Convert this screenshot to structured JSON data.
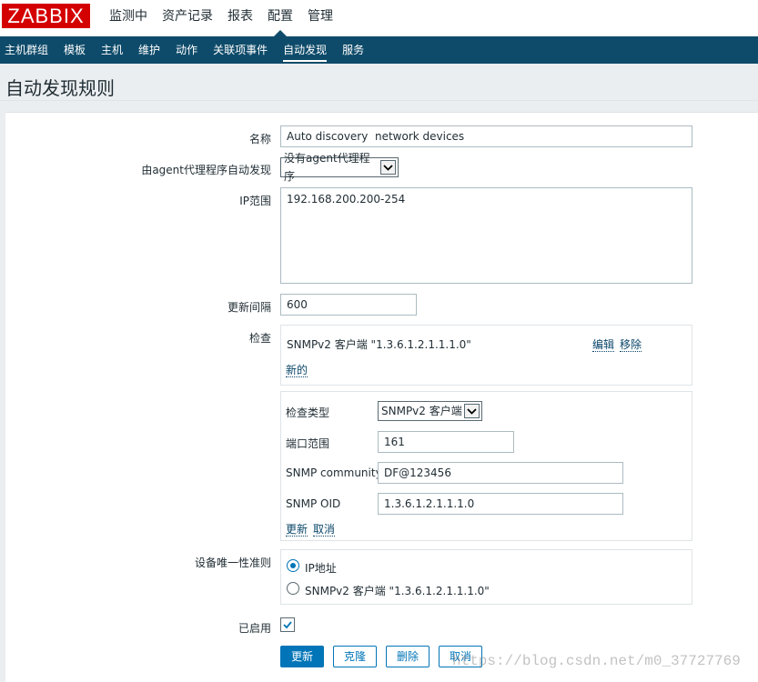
{
  "logo": "ZABBIX",
  "main_nav": [
    "监测中",
    "资产记录",
    "报表",
    "配置",
    "管理"
  ],
  "main_nav_active": "配置",
  "sub_nav": [
    "主机群组",
    "模板",
    "主机",
    "维护",
    "动作",
    "关联项事件",
    "自动发现",
    "服务"
  ],
  "sub_nav_active": "自动发现",
  "page_title": "自动发现规则",
  "form": {
    "name_label": "名称",
    "name_value": "Auto discovery  network devices",
    "proxy_label": "由agent代理程序自动发现",
    "proxy_value": "没有agent代理程序",
    "ip_label": "IP范围",
    "ip_value": "192.168.200.200-254",
    "interval_label": "更新间隔",
    "interval_value": "600",
    "checks_label": "检查",
    "check_item": "SNMPv2 客户端 \"1.3.6.1.2.1.1.1.0\"",
    "edit_link": "编辑",
    "remove_link": "移除",
    "new_link": "新的",
    "check_edit": {
      "type_label": "检查类型",
      "type_value": "SNMPv2 客户端",
      "port_label": "端口范围",
      "port_value": "161",
      "community_label": "SNMP community",
      "community_value": "DF@123456",
      "oid_label": "SNMP OID",
      "oid_value": "1.3.6.1.2.1.1.1.0",
      "update_link": "更新",
      "cancel_link": "取消"
    },
    "uniqueness_label": "设备唯一性准则",
    "uniqueness_options": [
      "IP地址",
      "SNMPv2 客户端 \"1.3.6.1.2.1.1.1.0\""
    ],
    "uniqueness_selected": 0,
    "enabled_label": "已启用",
    "enabled": true,
    "buttons": {
      "update": "更新",
      "clone": "克隆",
      "delete": "删除",
      "cancel": "取消"
    }
  },
  "watermark": "https://blog.csdn.net/m0_37727769",
  "colors": {
    "logo_red": "#d40000",
    "nav_dark": "#0e4b6a",
    "accent_blue": "#0275b8",
    "link_blue": "#0a466a"
  }
}
